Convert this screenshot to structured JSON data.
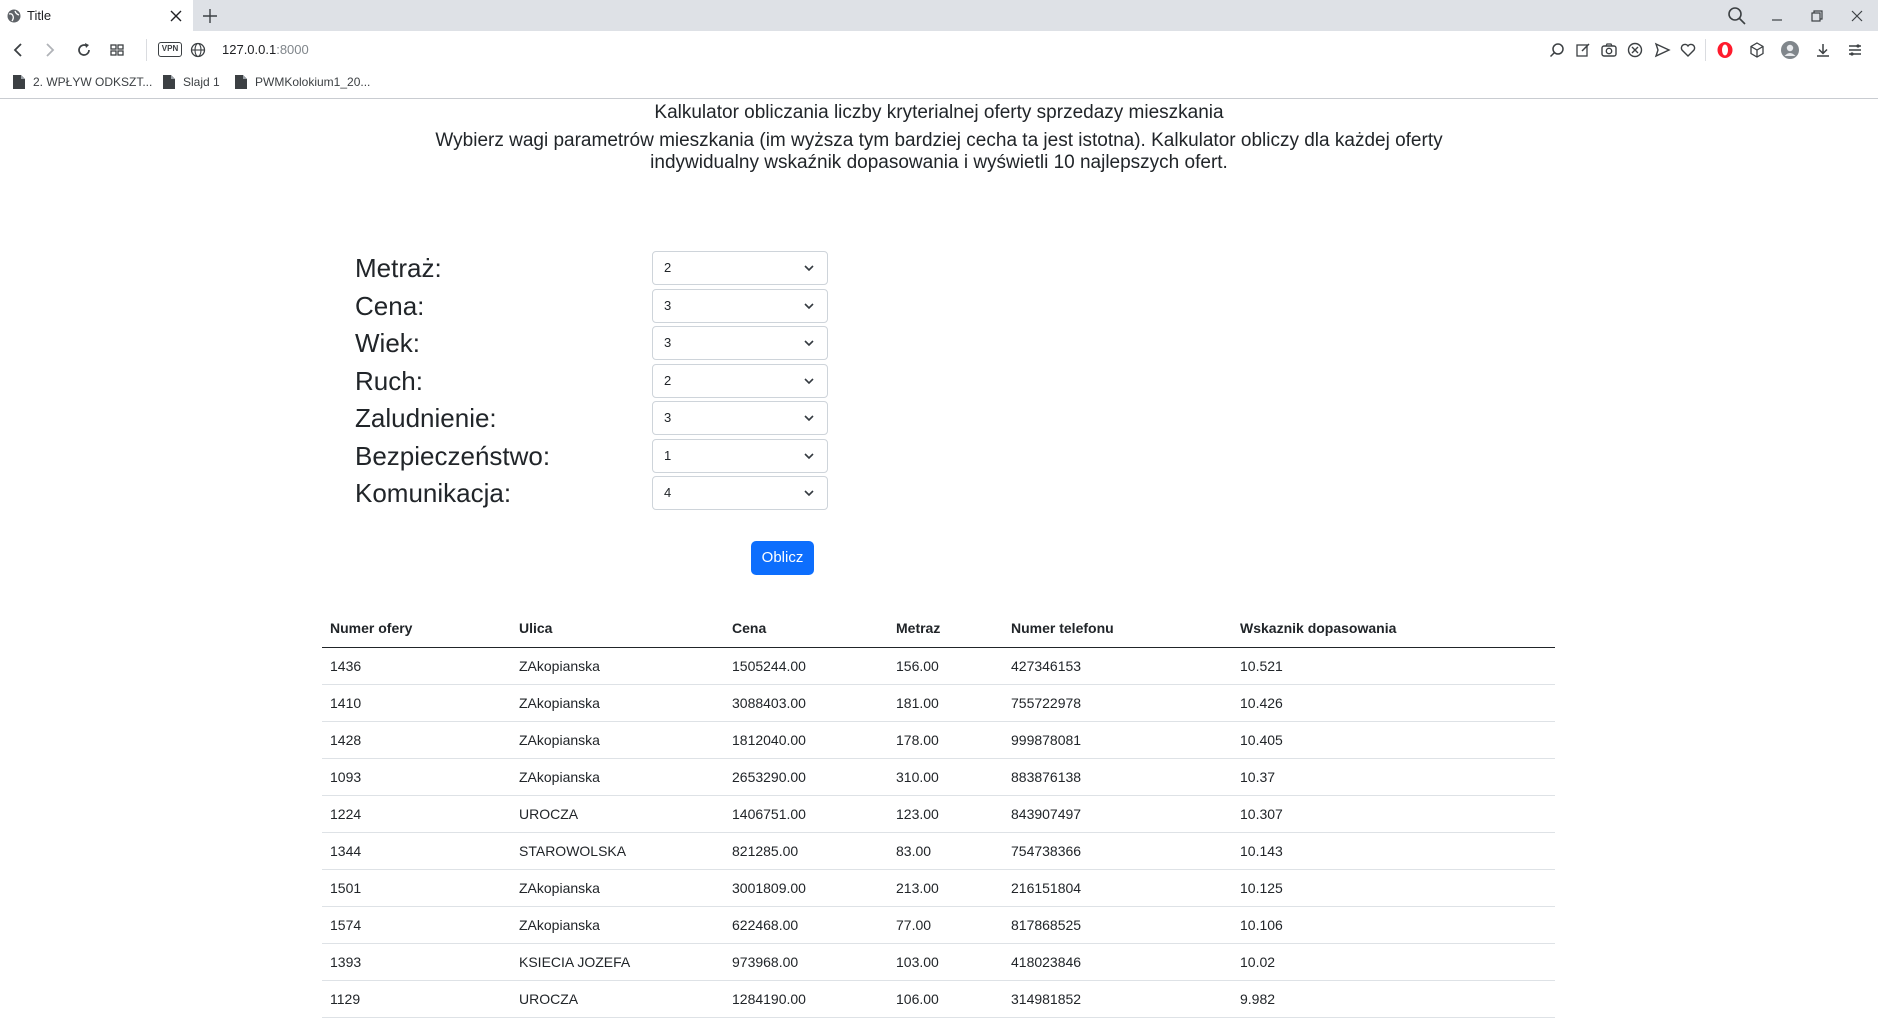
{
  "browser": {
    "tab_title": "Title",
    "url_host": "127.0.0.1",
    "url_port": ":8000",
    "vpn_label": "VPN",
    "bookmarks": [
      "2. WPŁYW ODKSZT...",
      "Slajd 1",
      "PWMKolokium1_20..."
    ]
  },
  "page": {
    "headline": "Kalkulator obliczania liczby kryterialnej oferty sprzedazy mieszkania",
    "subline": "Wybierz wagi parametrów mieszkania (im wyższa tym bardziej cecha ta jest istotna). Kalkulator obliczy dla każdej oferty indywidualny wskaźnik dopasowania i wyświetli 10 najlepszych ofert.",
    "fields": [
      {
        "label": "Metraż:",
        "value": "2"
      },
      {
        "label": "Cena:",
        "value": "3"
      },
      {
        "label": "Wiek:",
        "value": "3"
      },
      {
        "label": "Ruch:",
        "value": "2"
      },
      {
        "label": "Zaludnienie:",
        "value": "3"
      },
      {
        "label": "Bezpieczeństwo:",
        "value": "1"
      },
      {
        "label": "Komunikacja:",
        "value": "4"
      }
    ],
    "button_label": "Oblicz"
  },
  "table": {
    "headers": [
      "Numer ofery",
      "Ulica",
      "Cena",
      "Metraz",
      "Numer telefonu",
      "Wskaznik dopasowania"
    ],
    "rows": [
      [
        "1436",
        "ZAkopianska",
        "1505244.00",
        "156.00",
        "427346153",
        "10.521"
      ],
      [
        "1410",
        "ZAkopianska",
        "3088403.00",
        "181.00",
        "755722978",
        "10.426"
      ],
      [
        "1428",
        "ZAkopianska",
        "1812040.00",
        "178.00",
        "999878081",
        "10.405"
      ],
      [
        "1093",
        "ZAkopianska",
        "2653290.00",
        "310.00",
        "883876138",
        "10.37"
      ],
      [
        "1224",
        "UROCZA",
        "1406751.00",
        "123.00",
        "843907497",
        "10.307"
      ],
      [
        "1344",
        "STAROWOLSKA",
        "821285.00",
        "83.00",
        "754738366",
        "10.143"
      ],
      [
        "1501",
        "ZAkopianska",
        "3001809.00",
        "213.00",
        "216151804",
        "10.125"
      ],
      [
        "1574",
        "ZAkopianska",
        "622468.00",
        "77.00",
        "817868525",
        "10.106"
      ],
      [
        "1393",
        "KSIECIA JOZEFA",
        "973968.00",
        "103.00",
        "418023846",
        "10.02"
      ],
      [
        "1129",
        "UROCZA",
        "1284190.00",
        "106.00",
        "314981852",
        "9.982"
      ]
    ]
  }
}
